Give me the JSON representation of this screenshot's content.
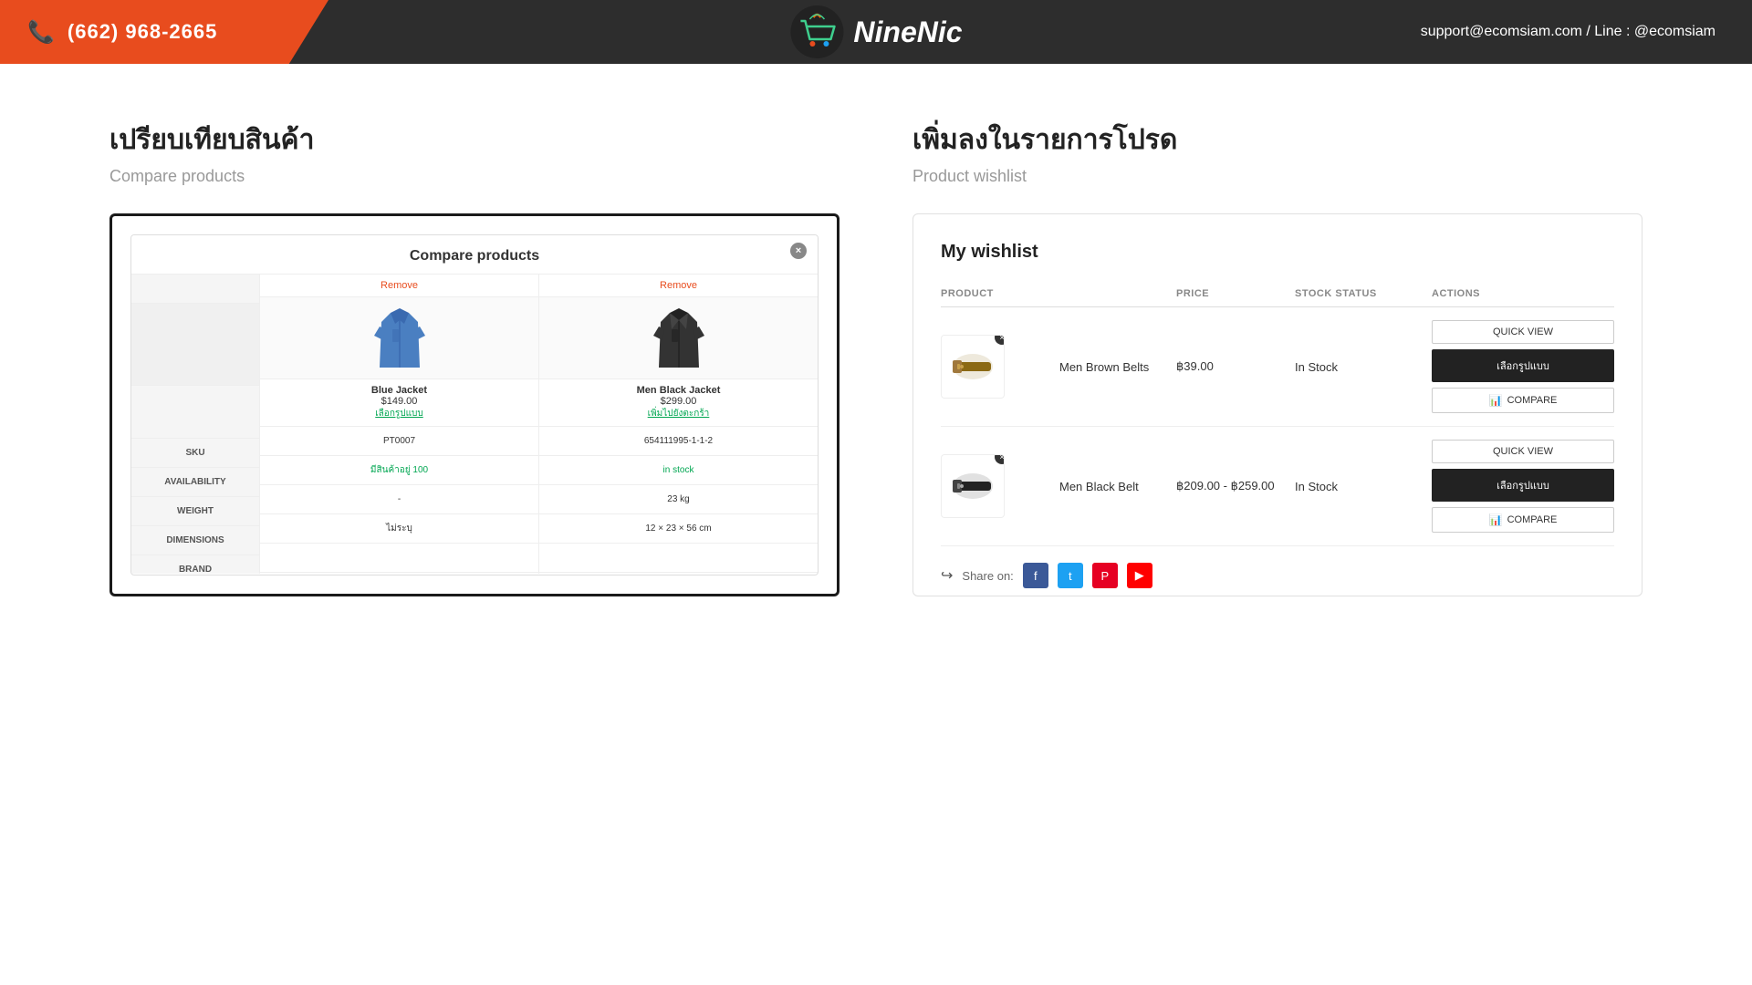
{
  "header": {
    "phone": "(662) 968-2665",
    "logo_text": "NineNic",
    "contact": "support@ecomsiam.com / Line : @ecomsiam"
  },
  "compare_section": {
    "title_thai": "เปรียบเทียบสินค้า",
    "title_en": "Compare products",
    "card_title": "Compare products",
    "close_label": "×",
    "remove_label_1": "Remove",
    "remove_label_2": "Remove",
    "product1": {
      "name": "Blue Jacket",
      "price": "$149.00",
      "link": "เลือกรูปแบบ"
    },
    "product2": {
      "name": "Men Black Jacket",
      "price": "$299.00",
      "link": "เพิ่มไปยังตะกร้า"
    },
    "rows": [
      {
        "label": "SKU",
        "val1": "PT0007",
        "val2": "654111995-1-1-2"
      },
      {
        "label": "AVAILABILITY",
        "val1": "มีสินค้าอยู่ 100",
        "val2": "in stock",
        "val1_green": true,
        "val2_green": true
      },
      {
        "label": "WEIGHT",
        "val1": "-",
        "val2": "23 kg"
      },
      {
        "label": "DIMENSIONS",
        "val1": "ไม่ระบุ",
        "val2": "12 × 23 × 56 cm"
      },
      {
        "label": "BRAND",
        "val1": "",
        "val2": ""
      }
    ]
  },
  "wishlist_section": {
    "title_thai": "เพิ่มลงในรายการโปรด",
    "title_en": "Product wishlist",
    "card_title": "My wishlist",
    "table_headers": [
      "PRODUCT",
      "PRICE",
      "STOCK STATUS",
      "ACTIONS"
    ],
    "products": [
      {
        "name": "Men Brown Belts",
        "price": "฿39.00",
        "stock": "In Stock",
        "btn_quick": "QUICK VIEW",
        "btn_cart": "เลือกรูปแบบ",
        "btn_compare": "COMPARE"
      },
      {
        "name": "Men Black Belt",
        "price": "฿209.00 - ฿259.00",
        "stock": "In Stock",
        "btn_quick": "QUICK VIEW",
        "btn_cart": "เลือกรูปแบบ",
        "btn_compare": "COMPARE"
      }
    ],
    "share_label": "Share on:"
  }
}
